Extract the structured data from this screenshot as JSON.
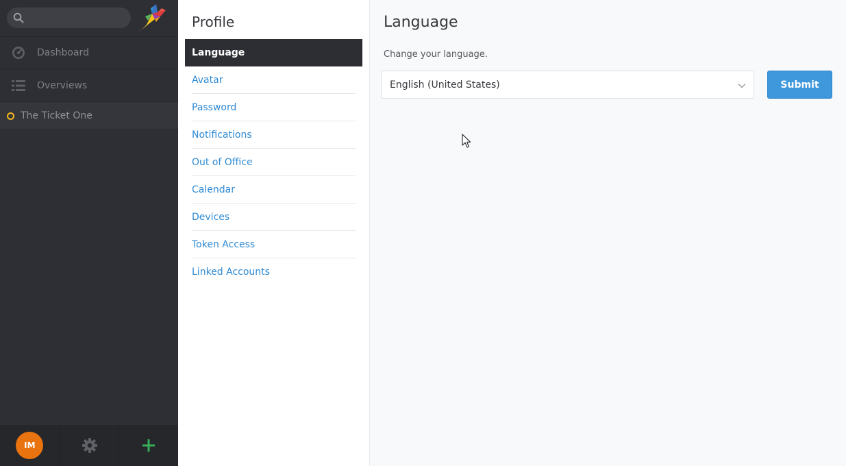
{
  "sidebar": {
    "search": {
      "placeholder": "",
      "value": ""
    },
    "nav": [
      {
        "label": "Dashboard",
        "icon": "dashboard-icon"
      },
      {
        "label": "Overviews",
        "icon": "list-icon"
      }
    ],
    "ticket": {
      "label": "The Ticket One",
      "status_color": "#f5b61c"
    },
    "bottom": {
      "avatar_initials": "IM",
      "avatar_color": "#e9730f",
      "settings_icon": "gear-icon",
      "add_icon": "plus-icon",
      "add_color": "#38ae5a"
    }
  },
  "profile": {
    "title": "Profile",
    "items": [
      {
        "label": "Language"
      },
      {
        "label": "Avatar"
      },
      {
        "label": "Password"
      },
      {
        "label": "Notifications"
      },
      {
        "label": "Out of Office"
      },
      {
        "label": "Calendar"
      },
      {
        "label": "Devices"
      },
      {
        "label": "Token Access"
      },
      {
        "label": "Linked Accounts"
      }
    ],
    "active_item": "Language"
  },
  "main": {
    "title": "Language",
    "description": "Change your language.",
    "language_select": {
      "value": "English (United States)",
      "icon": "chevron-down-icon"
    },
    "submit_label": "Submit"
  },
  "colors": {
    "accent": "#3f97dc",
    "link": "#2f8ad3",
    "sidebar_bg": "#2e2f34"
  }
}
